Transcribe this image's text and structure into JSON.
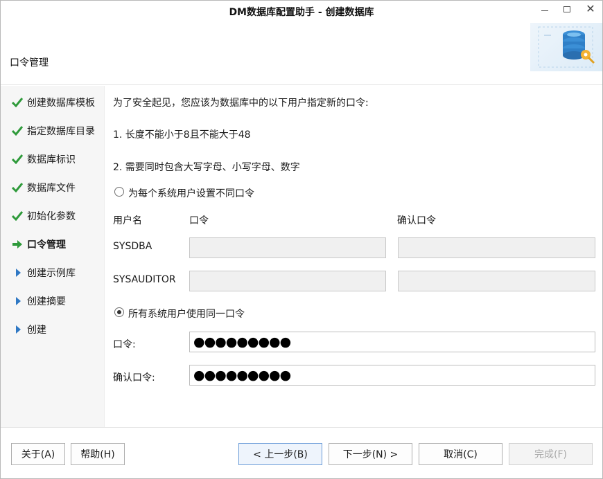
{
  "window": {
    "title": "DM数据库配置助手 - 创建数据库",
    "minimize_glyph": "—",
    "maximize_glyph": "☐",
    "close_glyph": "✕"
  },
  "header": {
    "heading": "口令管理",
    "art_icon": "database-settings-icon"
  },
  "steps": [
    {
      "label": "创建数据库模板",
      "state": "done"
    },
    {
      "label": "指定数据库目录",
      "state": "done"
    },
    {
      "label": "数据库标识",
      "state": "done"
    },
    {
      "label": "数据库文件",
      "state": "done"
    },
    {
      "label": "初始化参数",
      "state": "done"
    },
    {
      "label": "口令管理",
      "state": "current"
    },
    {
      "label": "创建示例库",
      "state": "pending"
    },
    {
      "label": "创建摘要",
      "state": "pending"
    },
    {
      "label": "创建",
      "state": "pending"
    }
  ],
  "content": {
    "intro": "为了安全起见，您应该为数据库中的以下用户指定新的口令:",
    "rule1": "1. 长度不能小于8且不能大于48",
    "rule2": "2. 需要同时包含大写字母、小写字母、数字",
    "option_separate": {
      "label": "为每个系统用户设置不同口令",
      "selected": false
    },
    "table_headers": {
      "user": "用户名",
      "password": "口令",
      "confirm": "确认口令"
    },
    "users": [
      {
        "name": "SYSDBA",
        "password": "",
        "confirm": ""
      },
      {
        "name": "SYSAUDITOR",
        "password": "",
        "confirm": ""
      }
    ],
    "option_same": {
      "label": "所有系统用户使用同一口令",
      "selected": true
    },
    "password_label": "口令:",
    "password_value": "●●●●●●●●●",
    "confirm_label": "确认口令:",
    "confirm_value": "●●●●●●●●●"
  },
  "buttons": {
    "about": "关于(A)",
    "help": "帮助(H)",
    "back": "< 上一步(B)",
    "next": "下一步(N) >",
    "cancel": "取消(C)",
    "finish": "完成(F)"
  },
  "colors": {
    "check": "#2e9a3a",
    "arrow_current": "#2e9a3a",
    "arrow_pending": "#2f78c4",
    "sidebar_bg": "#f6f6f6"
  }
}
